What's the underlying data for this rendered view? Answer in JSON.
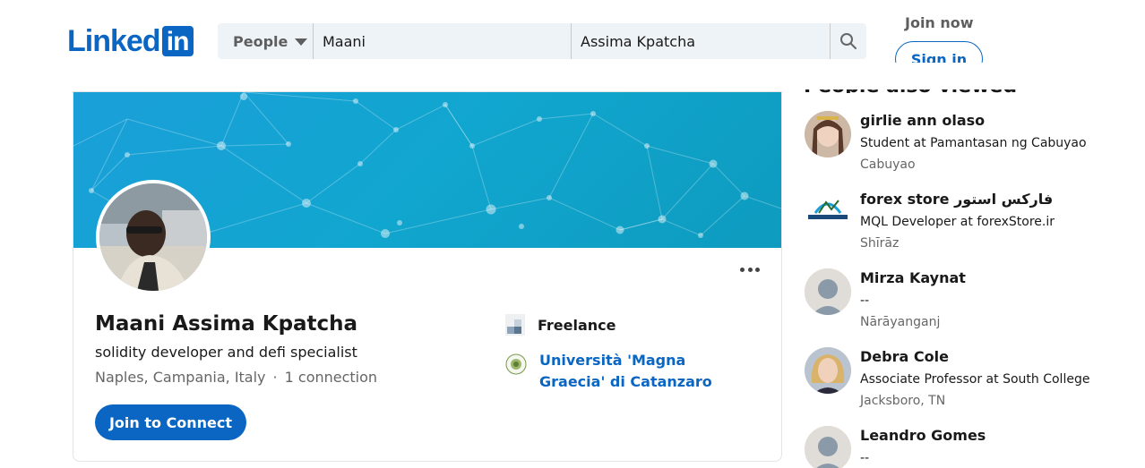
{
  "brand": {
    "logo_text": "Linked",
    "logo_box": "in",
    "color": "#0a66c2"
  },
  "search": {
    "type_label": "People",
    "first_name": "Maani",
    "last_name": "Assima Kpatcha",
    "icon": "search-icon"
  },
  "auth": {
    "join_now": "Join now",
    "sign_in": "Sign in"
  },
  "profile": {
    "name": "Maani Assima Kpatcha",
    "headline": "solidity developer and defi specialist",
    "location": "Naples, Campania, Italy",
    "separator": "·",
    "connections": "1 connection",
    "join_button": "Join to Connect",
    "experience": "Freelance",
    "education": "Università 'Magna Graecia' di Catanzaro"
  },
  "people_also_viewed": {
    "heading": "People also viewed",
    "items": [
      {
        "name": "girlie ann olaso",
        "headline": "Student at Pamantasan ng Cabuyao",
        "location": "Cabuyao"
      },
      {
        "name": "forex store فارکس استور",
        "headline": "MQL Developer at forexStore.ir",
        "location": "Shīrāz"
      },
      {
        "name": "Mirza Kaynat",
        "headline": "--",
        "location": "Nārāyanganj"
      },
      {
        "name": "Debra Cole",
        "headline": "Associate Professor at South College",
        "location": "Jacksboro, TN"
      },
      {
        "name": "Leandro Gomes",
        "headline": "--",
        "location": ""
      }
    ]
  }
}
